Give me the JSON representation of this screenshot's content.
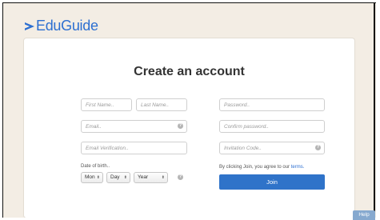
{
  "app": {
    "brand": "EduGuide"
  },
  "form": {
    "title": "Create an account",
    "first_name_placeholder": "First Name..",
    "last_name_placeholder": "Last Name..",
    "password_placeholder": "Password..",
    "email_placeholder": "Email..",
    "confirm_password_placeholder": "Confirm password..",
    "email_verification_placeholder": "Email Verification..",
    "invitation_code_placeholder": "Invitation Code..",
    "dob_label": "Date of birth..",
    "dob_month": "Mon",
    "dob_day": "Day",
    "dob_year": "Year",
    "hint_glyph": "?",
    "select_arrow": "⬍",
    "terms_prefix": "By clicking Join, you agree to our",
    "terms_link": "terms.",
    "join_label": "Join"
  },
  "help": {
    "label": "Help"
  },
  "colors": {
    "accent": "#2f73c9",
    "background": "#f3ede4"
  },
  "icons": {
    "logo": "play-triangle-icon",
    "hint": "question-circle-icon"
  }
}
